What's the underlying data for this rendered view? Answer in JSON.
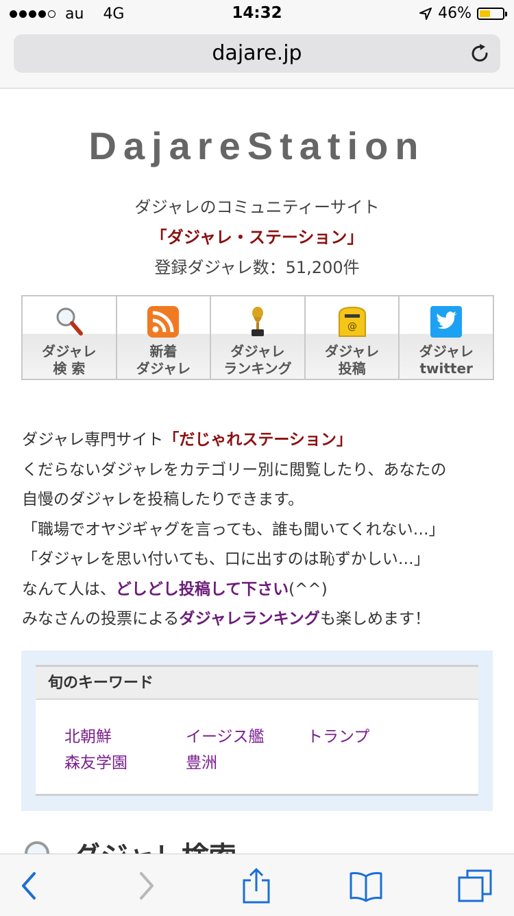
{
  "status_bar": {
    "carrier": "au",
    "network": "4G",
    "time": "14:32",
    "battery_percent": "46%",
    "battery_level": 0.46,
    "signal_bars": 4
  },
  "browser": {
    "url": "dajare.jp"
  },
  "site": {
    "logo": "DajareStation",
    "tagline": "ダジャレのコミュニティーサイト",
    "name": "「ダジャレ・ステーション」",
    "registered_count": "登録ダジャレ数：51,200件"
  },
  "nav": [
    {
      "line1": "ダジャレ",
      "line2": "検 索",
      "icon": "magnifier-icon"
    },
    {
      "line1": "新着",
      "line2": "ダジャレ",
      "icon": "rss-icon"
    },
    {
      "line1": "ダジャレ",
      "line2": "ランキング",
      "icon": "trophy-icon"
    },
    {
      "line1": "ダジャレ",
      "line2": "投稿",
      "icon": "mailbox-icon"
    },
    {
      "line1": "ダジャレ",
      "line2": "twitter",
      "icon": "twitter-bird-icon"
    }
  ],
  "description": {
    "line1_prefix": "ダジャレ専門サイト",
    "line1_highlight": "「だじゃれステーション」",
    "line2": "くだらないダジャレをカテゴリー別に閲覧したり、あなたの",
    "line3": "自慢のダジャレを投稿したりできます。",
    "line4": "「職場でオヤジギャグを言っても、誰も聞いてくれない…」",
    "line5": "「ダジャレを思い付いても、口に出すのは恥ずかしい…」",
    "line6_prefix": "なんて人は、",
    "line6_link": "どしどし投稿して下さい",
    "line6_suffix": "(^^)",
    "line7_prefix": "みなさんの投票による",
    "line7_link": "ダジャレランキング",
    "line7_suffix": "も楽しめます！"
  },
  "keywords": {
    "title": "旬のキーワード",
    "items": [
      "北朝鮮",
      "イージス艦",
      "トランプ",
      "森友学園",
      "豊洲"
    ]
  },
  "next_section": {
    "heading": "ダジャレ検索"
  },
  "toolbar": {
    "back": "back-chevron-icon",
    "forward": "forward-chevron-icon",
    "share": "share-icon",
    "bookmarks": "bookmarks-icon",
    "tabs": "tabs-icon"
  },
  "colors": {
    "accent_red": "#8b1010",
    "link_purple": "#7a1f8e",
    "ios_blue": "#1a6fd6"
  }
}
